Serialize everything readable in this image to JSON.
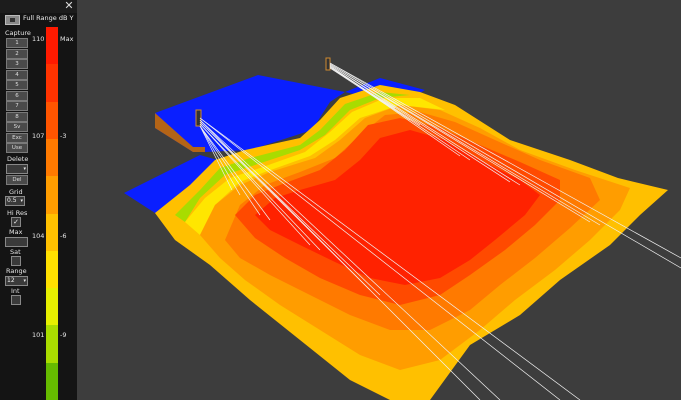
{
  "panel": {
    "close_glyph": "✕",
    "legend_title": "Full Range dB Y",
    "capture_label": "Capture",
    "capture_buttons": [
      "1",
      "2",
      "3",
      "4",
      "5",
      "6",
      "7",
      "8",
      "Sv",
      "Exc",
      "Use"
    ],
    "delete_label": "Delete",
    "delete_select_value": "",
    "del_button": "Del",
    "grid_label": "Grid",
    "grid_value": "0.5",
    "hires_label": "Hi Res",
    "hires_checked": "✓",
    "max_label": "Max",
    "max_value": "",
    "sat_label": "Sat",
    "range_label": "Range",
    "range_value": "12",
    "int_label": "Int"
  },
  "scale": {
    "left_ticks": [
      "110",
      "107",
      "104",
      "101"
    ],
    "right_ticks": [
      "Max",
      "-3",
      "-6",
      "-9"
    ],
    "colors_top_to_bottom": [
      "#ff1a00",
      "#ff3300",
      "#ff5500",
      "#ff7a00",
      "#ff9d00",
      "#ffc000",
      "#ffe000",
      "#e6f000",
      "#aadd00",
      "#66bb00"
    ]
  },
  "icons": {
    "close": "close-icon",
    "speaker": "speaker-icon"
  },
  "colors": {
    "floor_blue": "#0a1fff",
    "panel_bg": "#141414",
    "viewport_bg": "#3d3d3d"
  }
}
